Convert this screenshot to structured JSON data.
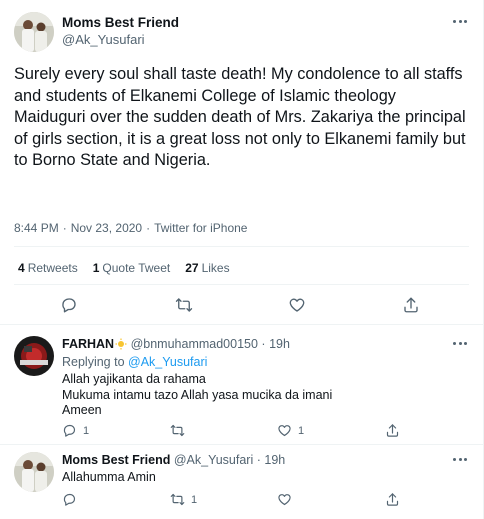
{
  "tweet": {
    "author_name": "Moms Best Friend",
    "author_handle": "@Ak_Yusufari",
    "text": "Surely every soul shall taste death! My condolence to all staffs and students of Elkanemi College of Islamic theology Maiduguri over the sudden death of Mrs. Zakariya the principal of girls section, it is a great loss not only to Elkanemi family but to Borno State and Nigeria.",
    "time": "8:44 PM",
    "separator": "·",
    "date": "Nov 23, 2020",
    "source": "Twitter for iPhone",
    "stats": {
      "retweets_count": "4",
      "retweets_label": "Retweets",
      "quotes_count": "1",
      "quotes_label": "Quote Tweet",
      "likes_count": "27",
      "likes_label": "Likes"
    },
    "action_icons": [
      "reply-icon",
      "retweet-icon",
      "like-icon",
      "share-icon"
    ]
  },
  "replies": [
    {
      "author_name": "FARHAN",
      "badge_icon": "sun-emoji-icon",
      "author_handle": "@bnmuhammad00150",
      "separator": "·",
      "time": "19h",
      "replying_prefix": "Replying to",
      "replying_to": "@Ak_Yusufari",
      "lines": [
        "Allah yajikanta da rahama",
        "Mukuma intamu tazo Allah yasa mucika da imani",
        "Ameen"
      ],
      "reply_count": "1",
      "retweet_count": "",
      "like_count": "1"
    },
    {
      "author_name": "Moms Best Friend",
      "author_handle": "@Ak_Yusufari",
      "separator": "·",
      "time": "19h",
      "lines": [
        "Allahumma Amin"
      ],
      "reply_count": "",
      "retweet_count": "1",
      "like_count": ""
    }
  ],
  "colors": {
    "text": "#0f1419",
    "muted": "#536471",
    "accent": "#1d9bf0",
    "divider": "#eff3f4"
  }
}
